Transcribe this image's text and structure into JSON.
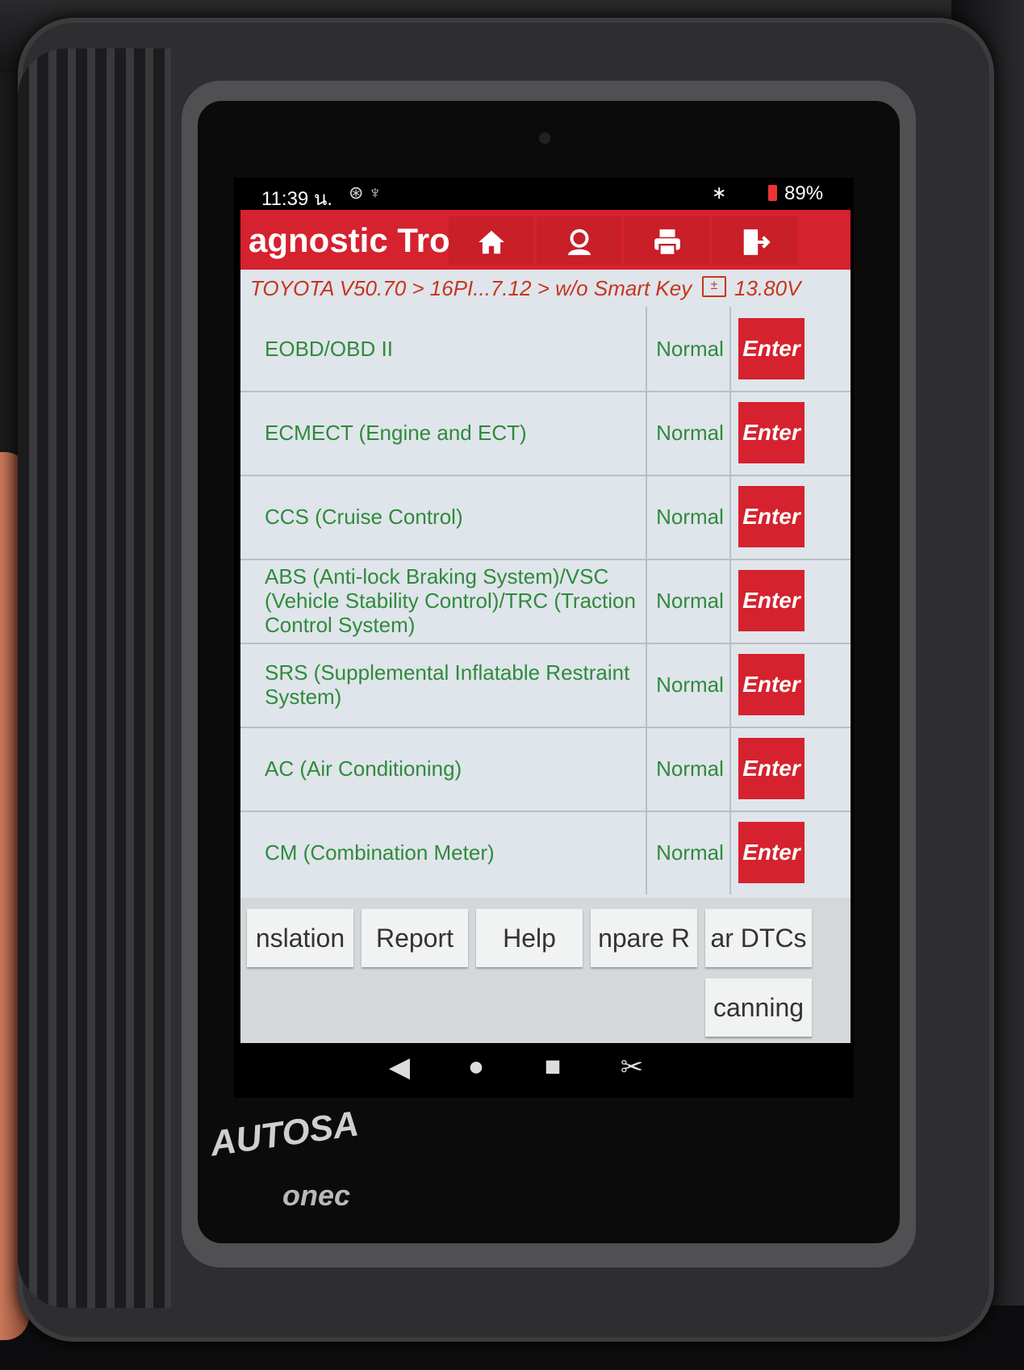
{
  "status_bar": {
    "time": "11:39 น.",
    "icons": "⊛ ♆",
    "bluetooth": "∗",
    "battery": "89%"
  },
  "toolbar": {
    "title": "agnostic Trou"
  },
  "breadcrumb": {
    "path": "TOYOTA V50.70 > 16PI...7.12 > w/o Smart Key",
    "voltage": "13.80V"
  },
  "systems": [
    {
      "name": "EOBD/OBD II",
      "status": "Normal",
      "action": "Enter"
    },
    {
      "name": "ECMECT (Engine and ECT)",
      "status": "Normal",
      "action": "Enter"
    },
    {
      "name": "CCS (Cruise Control)",
      "status": "Normal",
      "action": "Enter"
    },
    {
      "name": "ABS (Anti-lock Braking System)/VSC (Vehicle Stability Control)/TRC (Traction Control System)",
      "status": "Normal",
      "action": "Enter"
    },
    {
      "name": "SRS (Supplemental Inflatable Restraint System)",
      "status": "Normal",
      "action": "Enter"
    },
    {
      "name": "AC (Air Conditioning)",
      "status": "Normal",
      "action": "Enter"
    },
    {
      "name": "CM (Combination Meter)",
      "status": "Normal",
      "action": "Enter"
    }
  ],
  "function_buttons": {
    "translation": "nslation",
    "report": "Report",
    "help": "Help",
    "compare": "npare R",
    "clear_dtcs": "ar DTCs",
    "scanning": "canning"
  },
  "device_brand": {
    "line1": "AUTOSA",
    "line2": "onec"
  },
  "colors": {
    "accent_red": "#d5222e",
    "status_green": "#2f8a3c",
    "breadcrumb_text": "#c8341e"
  }
}
